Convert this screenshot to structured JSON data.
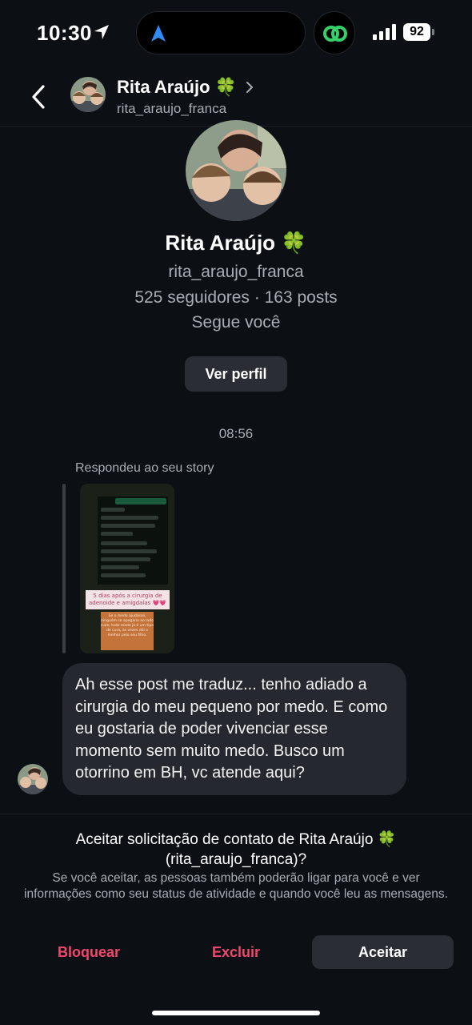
{
  "status_bar": {
    "time": "10:30",
    "battery": "92",
    "location_icon": "location-arrow-icon",
    "nav_icon": "navigation-arrow-icon",
    "app_icon": "chain-link-icon"
  },
  "header": {
    "name": "Rita Araújo",
    "emoji": "🍀",
    "username": "rita_araujo_franca"
  },
  "profile": {
    "name": "Rita Araújo",
    "emoji": "🍀",
    "username": "rita_araujo_franca",
    "stats": "525 seguidores · 163 posts",
    "follows_you": "Segue você",
    "view_profile_label": "Ver perfil"
  },
  "conversation": {
    "timestamp": "08:56",
    "reply_note": "Respondeu ao seu story",
    "story_caption": "5 dias após a cirurgia de adenoide e amígdalas 💗💗",
    "story_overlay": "Se o medo ajudasse, ninguém se apegaria ao lado ruim; todo medo já é um tipo de cura, às vezes dói o melhor pelo seu filho.",
    "message": "Ah esse post me traduz... tenho adiado a cirurgia do meu pequeno por medo. E como eu gostaria de poder vivenciar esse momento sem muito medo. Busco um otorrino em BH, vc atende aqui?"
  },
  "request": {
    "title": "Aceitar solicitação de contato de Rita Araújo 🍀 (rita_araujo_franca)?",
    "description": "Se você aceitar, as pessoas também poderão ligar para você e ver informações como seu status de atividade e quando você leu as mensagens.",
    "block_label": "Bloquear",
    "delete_label": "Excluir",
    "accept_label": "Aceitar"
  },
  "colors": {
    "background": "#0c0f14",
    "bubble": "#25282e",
    "button": "#2a2d33",
    "danger": "#f1476e",
    "secondary_text": "#a8acb3"
  }
}
